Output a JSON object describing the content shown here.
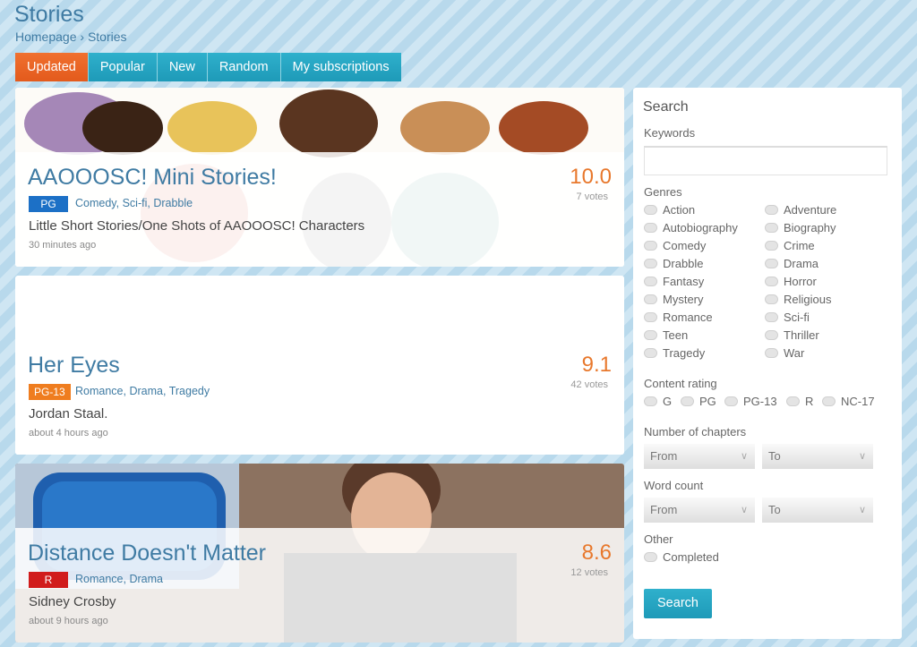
{
  "page": {
    "title": "Stories",
    "breadcrumb": {
      "home": "Homepage",
      "sep": "›",
      "current": "Stories"
    }
  },
  "tabs": [
    "Updated",
    "Popular",
    "New",
    "Random",
    "My subscriptions"
  ],
  "stories": [
    {
      "title": "AAOOOSC! Mini Stories!",
      "rating": "PG",
      "rating_color": "#1c70c6",
      "genres": [
        "Comedy",
        "Sci-fi",
        "Drabble"
      ],
      "description": "Little Short Stories/One Shots of AAOOOSC! Characters",
      "time": "30 minutes ago",
      "score": "10.0",
      "votes": "7 votes"
    },
    {
      "title": "Her Eyes",
      "rating": "PG-13",
      "rating_color": "#ef7d1f",
      "genres": [
        "Romance",
        "Drama",
        "Tragedy"
      ],
      "description": "Jordan Staal.",
      "time": "about 4 hours ago",
      "score": "9.1",
      "votes": "42 votes"
    },
    {
      "title": "Distance Doesn't Matter",
      "rating": "R",
      "rating_color": "#d11c1c",
      "genres": [
        "Romance",
        "Drama"
      ],
      "description": "Sidney Crosby",
      "time": "about 9 hours ago",
      "score": "8.6",
      "votes": "12 votes"
    }
  ],
  "sidebar": {
    "title": "Search",
    "keywords_label": "Keywords",
    "genres_label": "Genres",
    "genres_left": [
      "Action",
      "Autobiography",
      "Comedy",
      "Drabble",
      "Fantasy",
      "Mystery",
      "Romance",
      "Teen",
      "Tragedy"
    ],
    "genres_right": [
      "Adventure",
      "Biography",
      "Crime",
      "Drama",
      "Horror",
      "Religious",
      "Sci-fi",
      "Thriller",
      "War"
    ],
    "content_rating_label": "Content rating",
    "ratings": [
      "G",
      "PG",
      "PG-13",
      "R",
      "NC-17"
    ],
    "chapters_label": "Number of chapters",
    "word_count_label": "Word count",
    "from": "From",
    "to": "To",
    "other_label": "Other",
    "completed": "Completed",
    "search_button": "Search"
  }
}
